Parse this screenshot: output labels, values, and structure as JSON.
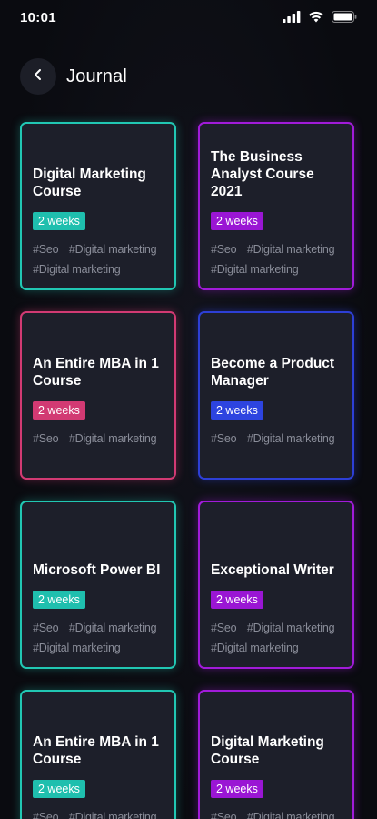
{
  "status_bar": {
    "time": "10:01",
    "icons": [
      "signal-icon",
      "wifi-icon",
      "battery-icon"
    ]
  },
  "header": {
    "back_icon": "chevron-left-icon",
    "title": "Journal"
  },
  "colors": {
    "teal": "#21c7b3",
    "purple": "#a11bd9",
    "pink": "#d23a73",
    "blue": "#2d3fd6",
    "card_bg": "#1d1f2a",
    "tag_text": "#8a8d99"
  },
  "cards": [
    {
      "title": "Digital Marketing Course",
      "duration": "2 weeks",
      "tags": [
        "#Seo",
        "#Digital marketing",
        "#Digital marketing"
      ],
      "color": "teal"
    },
    {
      "title": "The Business Analyst Course 2021",
      "duration": "2 weeks",
      "tags": [
        "#Seo",
        "#Digital marketing",
        "#Digital marketing"
      ],
      "color": "purple"
    },
    {
      "title": "An Entire MBA in 1 Course",
      "duration": "2 weeks",
      "tags": [
        "#Seo",
        "#Digital marketing"
      ],
      "color": "pink"
    },
    {
      "title": "Become a Product Manager",
      "duration": "2 weeks",
      "tags": [
        "#Seo",
        "#Digital marketing"
      ],
      "color": "blue"
    },
    {
      "title": "Microsoft Power BI",
      "duration": "2 weeks",
      "tags": [
        "#Seo",
        "#Digital marketing",
        "#Digital marketing"
      ],
      "color": "teal"
    },
    {
      "title": "Exceptional Writer",
      "duration": "2 weeks",
      "tags": [
        "#Seo",
        "#Digital marketing",
        "#Digital marketing"
      ],
      "color": "purple"
    },
    {
      "title": "An Entire MBA in 1 Course",
      "duration": "2 weeks",
      "tags": [
        "#Seo",
        "#Digital marketing"
      ],
      "color": "teal"
    },
    {
      "title": "Digital Marketing Course",
      "duration": "2 weeks",
      "tags": [
        "#Seo",
        "#Digital marketing"
      ],
      "color": "purple"
    }
  ]
}
